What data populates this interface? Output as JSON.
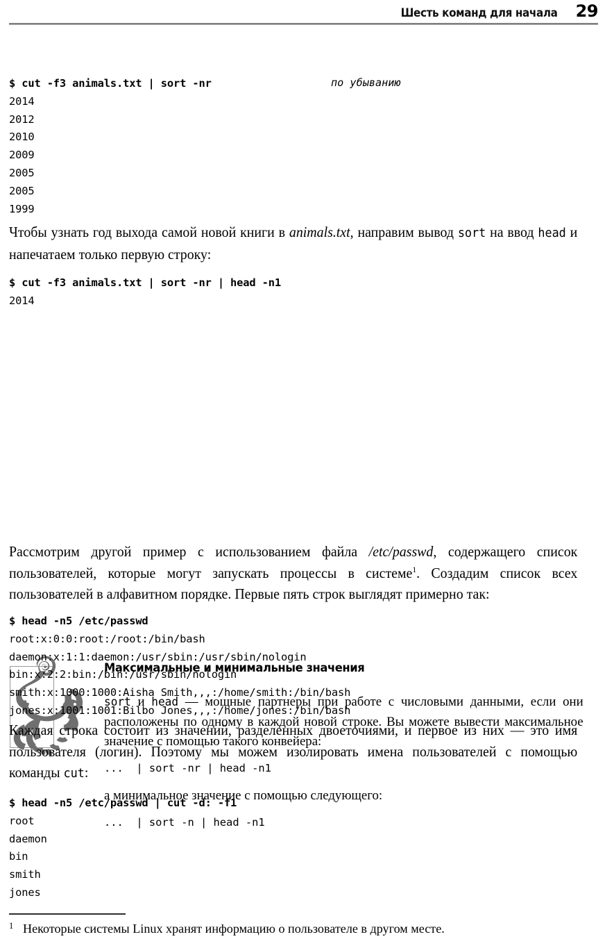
{
  "header": {
    "title": "Шесть команд для начала",
    "page_number": "29"
  },
  "code_block_1": {
    "command": "$ cut -f3 animals.txt | sort -nr",
    "annotation": "по убыванию",
    "output": [
      "2014",
      "2012",
      "2010",
      "2009",
      "2005",
      "2005",
      "1999"
    ]
  },
  "paragraph_1": {
    "part1": "Чтобы узнать год выхода самой новой книги в ",
    "italic": "animals.txt",
    "part2": ", направим вывод ",
    "mono1": "sort",
    "part3": " на ввод ",
    "mono2": "head",
    "part4": " и напечатаем только первую строку:"
  },
  "code_block_2": {
    "command": "$ cut -f3 animals.txt | sort -nr | head -n1",
    "output": [
      "2014"
    ]
  },
  "note": {
    "icon": "monkey-silhouette-icon",
    "title": "Максимальные и минимальные значения",
    "body": {
      "mono1": "sort",
      "part1": " и ",
      "mono2": "head",
      "part2": " — мощные партнеры при работе с числовыми данными, если они расположены по одному в каждой новой строке. Вы можете вывести максимальное значение с помощью такого конвейера:"
    },
    "code_max": "...  | sort -nr | head -n1",
    "middle_text": "а минимальное значение с помощью следующего:",
    "code_min": "...  | sort -n | head -n1"
  },
  "paragraph_2": {
    "part1": "Рассмотрим другой пример с использованием файла ",
    "italic": "/etc/passwd",
    "part2": ", содержащего список пользователей, которые могут запускать процессы в системе",
    "footnote_marker": "1",
    "part3": ". Создадим список всех пользователей в алфавитном порядке. Первые пять строк выглядят примерно так:"
  },
  "code_block_3": {
    "command": "$ head -n5 /etc/passwd",
    "output": [
      "root:x:0:0:root:/root:/bin/bash",
      "daemon:x:1:1:daemon:/usr/sbin:/usr/sbin/nologin",
      "bin:x:2:2:bin:/bin:/usr/sbin/nologin",
      "smith:x:1000:1000:Aisha Smith,,,:/home/smith:/bin/bash",
      "jones:x:1001:1001:Bilbo Jones,,,:/home/jones:/bin/bash"
    ]
  },
  "paragraph_3": {
    "part1": "Каждая строка состоит из значений, разделенных двоеточиями, и первое из них — это имя пользователя (логин). Поэтому мы можем изолировать имена пользователей с помощью команды ",
    "mono1": "cut",
    "part2": ":"
  },
  "code_block_4": {
    "command": "$ head -n5 /etc/passwd | cut -d: -f1",
    "output": [
      "root",
      "daemon",
      "bin",
      "smith",
      "jones"
    ]
  },
  "footnote": {
    "marker": "1",
    "text": "Некоторые системы Linux хранят информацию о пользователе в другом месте."
  },
  "colors": {
    "text": "#000000",
    "rule": "#6f6f6f",
    "figure_border": "#9a9a9a",
    "monkey_fill": "#6f6f6f"
  }
}
